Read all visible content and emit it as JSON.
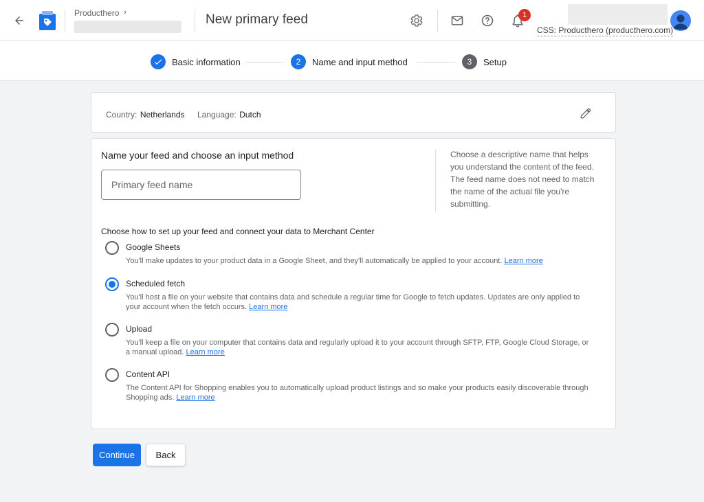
{
  "header": {
    "account_name": "Producthero",
    "page_title": "New primary feed",
    "notifications_count": "1",
    "css_label": "CSS: Producthero (producthero.com)"
  },
  "stepper": {
    "steps": [
      {
        "number": "",
        "label": "Basic information",
        "state": "done"
      },
      {
        "number": "2",
        "label": "Name and input method",
        "state": "active"
      },
      {
        "number": "3",
        "label": "Setup",
        "state": "pending"
      }
    ]
  },
  "meta": {
    "country_label": "Country:",
    "country_value": "Netherlands",
    "language_label": "Language:",
    "language_value": "Dutch"
  },
  "form": {
    "section_title": "Name your feed and choose an input method",
    "feed_name_placeholder": "Primary feed name",
    "feed_name_value": "",
    "help_text": "Choose a descriptive name that helps you understand the content of the feed. The feed name does not need to match the name of the actual file you're submitting.",
    "method_heading": "Choose how to set up your feed and connect your data to Merchant Center",
    "options": [
      {
        "title": "Google Sheets",
        "description": "You'll make updates to your product data in a Google Sheet, and they'll automatically be applied to your account.",
        "link": "Learn more",
        "selected": false
      },
      {
        "title": "Scheduled fetch",
        "description": "You'll host a file on your website that contains data and schedule a regular time for Google to fetch updates. Updates are only applied to your account when the fetch occurs.",
        "link": "Learn more",
        "selected": true
      },
      {
        "title": "Upload",
        "description": "You'll keep a file on your computer that contains data and regularly upload it to your account through SFTP, FTP, Google Cloud Storage, or a manual upload.",
        "link": "Learn more",
        "selected": false
      },
      {
        "title": "Content API",
        "description": "The Content API for Shopping enables you to automatically upload product listings and so make your products easily discoverable through Shopping ads.",
        "link": "Learn more",
        "selected": false
      }
    ]
  },
  "actions": {
    "continue_label": "Continue",
    "back_label": "Back"
  },
  "colors": {
    "accent": "#1a73e8",
    "badge": "#d93025",
    "pending_step": "#5f6368"
  }
}
